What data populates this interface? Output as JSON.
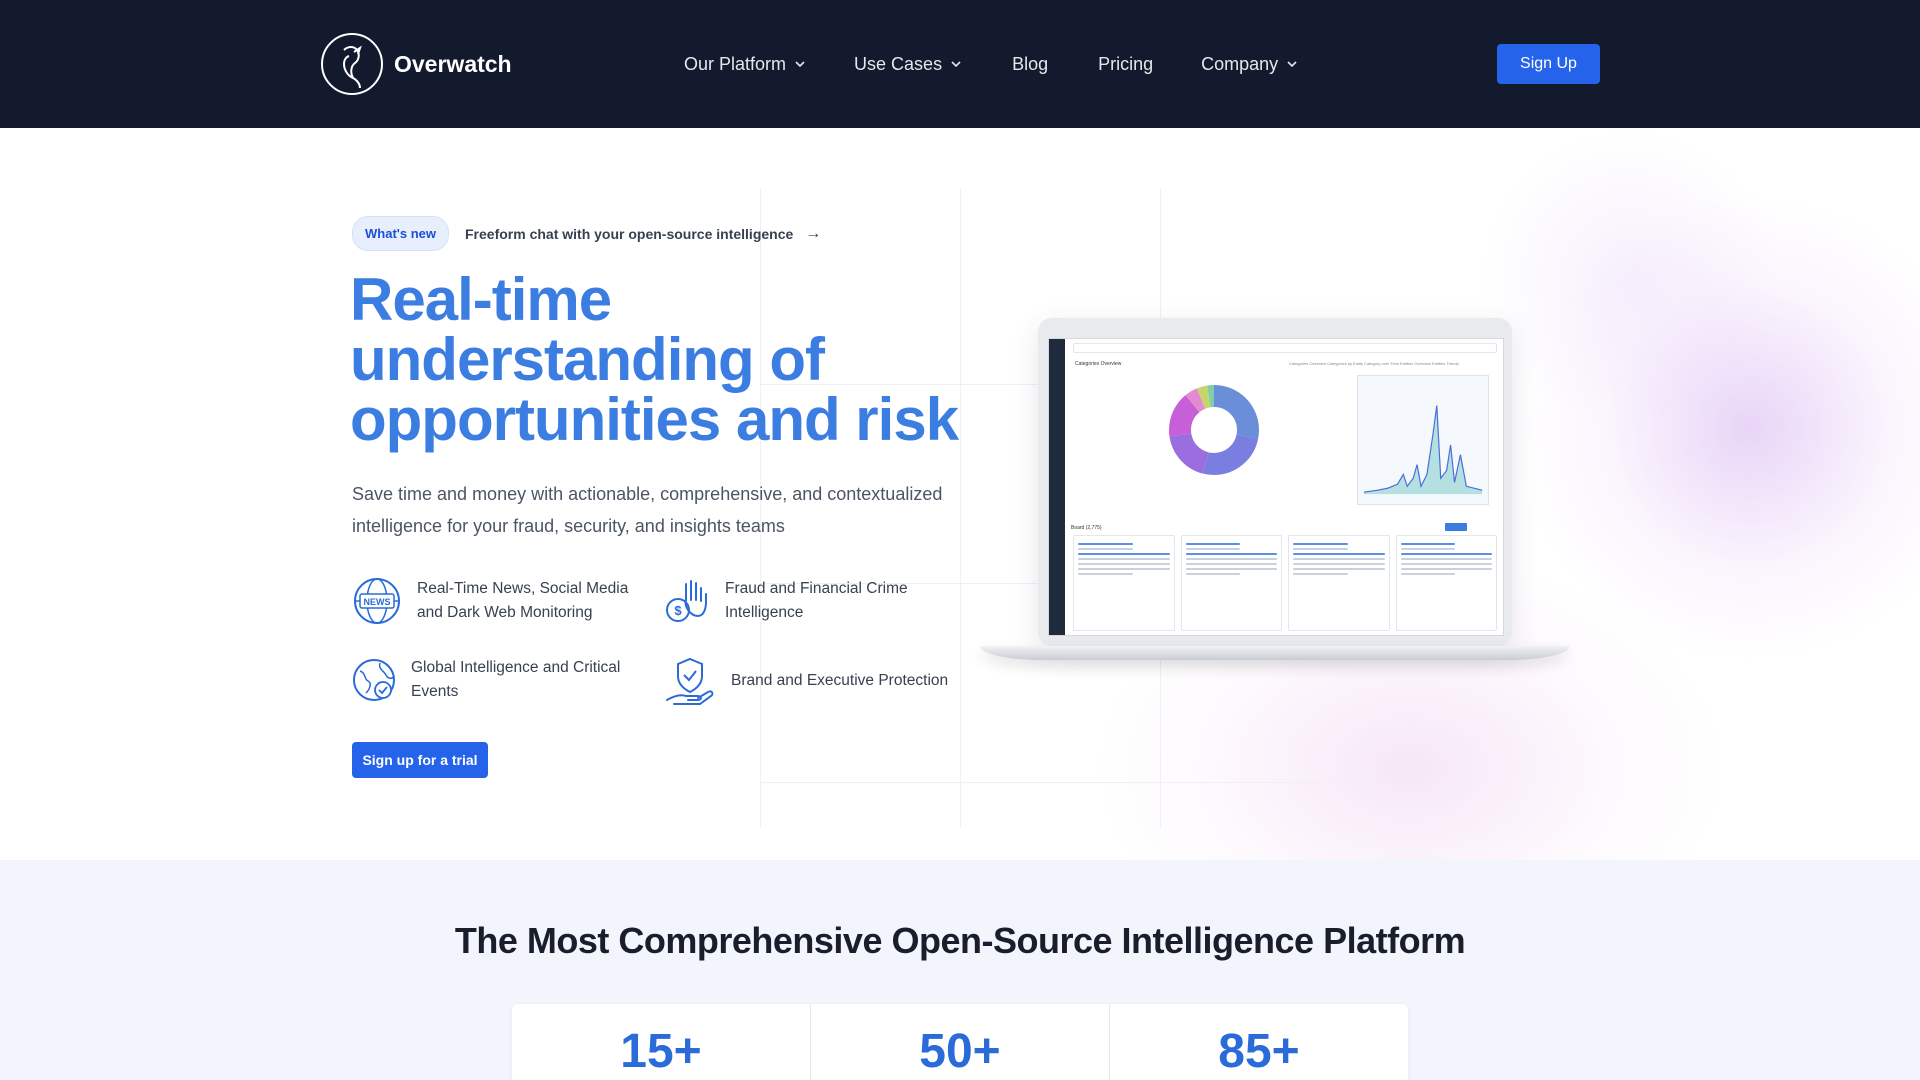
{
  "nav": {
    "logo_text": "Overwatch",
    "links": [
      {
        "label": "Our Platform",
        "has_dropdown": true
      },
      {
        "label": "Use Cases",
        "has_dropdown": true
      },
      {
        "label": "Blog",
        "has_dropdown": false
      },
      {
        "label": "Pricing",
        "has_dropdown": false
      },
      {
        "label": "Company",
        "has_dropdown": true
      }
    ],
    "signup_label": "Sign Up"
  },
  "hero": {
    "whatsnew_pill": "What's new",
    "whatsnew_text": "Freeform chat with your open-source intelligence",
    "whatsnew_arrow": "→",
    "headline": "Real-time understanding of opportunities and risk",
    "subtext": "Save time and money with actionable, comprehensive, and contextualized intelligence for your fraud, security, and insights teams",
    "features": [
      {
        "icon": "news-globe-icon",
        "label": "Real-Time News, Social Media and Dark Web Monitoring"
      },
      {
        "icon": "money-hand-icon",
        "label": "Fraud and Financial Crime Intelligence"
      },
      {
        "icon": "globe-check-icon",
        "label": "Global Intelligence and Critical Events"
      },
      {
        "icon": "shield-hand-icon",
        "label": "Brand and Executive Protection"
      }
    ],
    "cta_label": "Sign up for a trial",
    "laptop": {
      "panel_title": "Categories Overview",
      "tabs_text": "Categories Overview   Categories by Entity   Category over Time   Entities Overview   Entities Trends",
      "board_title": "Board (2,775)"
    }
  },
  "lower": {
    "title": "The Most Comprehensive Open-Source Intelligence Platform",
    "stats": [
      "15+",
      "50+",
      "85+"
    ]
  },
  "colors": {
    "nav_bg": "#131a2e",
    "accent": "#2563eb",
    "headline": "#3b7de0",
    "lower_bg": "#f2f5fb"
  }
}
